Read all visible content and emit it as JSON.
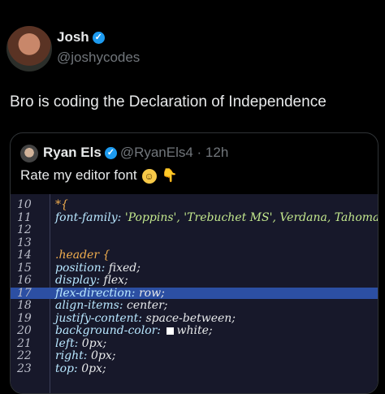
{
  "post": {
    "author_name": "Josh",
    "author_handle": "@joshycodes",
    "text": "Bro is coding the Declaration of Independence"
  },
  "quote": {
    "author_name": "Ryan Els",
    "author_handle": "@RyanEls4 · 12h",
    "text": "Rate my editor font",
    "emojis": [
      "nerd-face-emoji",
      "pointing-down-emoji"
    ]
  },
  "editor": {
    "lines": [
      {
        "n": "10",
        "code": "*{"
      },
      {
        "n": "11",
        "code": "font-family: 'Poppins', 'Trebuchet MS', Verdana, Tahoma, H"
      },
      {
        "n": "12",
        "code": ""
      },
      {
        "n": "13",
        "code": ""
      },
      {
        "n": "14",
        "code": ".header {"
      },
      {
        "n": "15",
        "code": "position: fixed;"
      },
      {
        "n": "16",
        "code": "display: flex;"
      },
      {
        "n": "17",
        "code": "flex-direction: row;"
      },
      {
        "n": "18",
        "code": "align-items: center;"
      },
      {
        "n": "19",
        "code": "justify-content: space-between;"
      },
      {
        "n": "20",
        "code": "background-color: white;"
      },
      {
        "n": "21",
        "code": "left: 0px;"
      },
      {
        "n": "22",
        "code": "right: 0px;"
      },
      {
        "n": "23",
        "code": "top: 0px;"
      }
    ],
    "highlighted_line": "17",
    "colors": {
      "background": "#17182a",
      "highlight": "#2c4fa3",
      "property": "#b8e7ff",
      "selector": "#f0ad4e"
    }
  }
}
